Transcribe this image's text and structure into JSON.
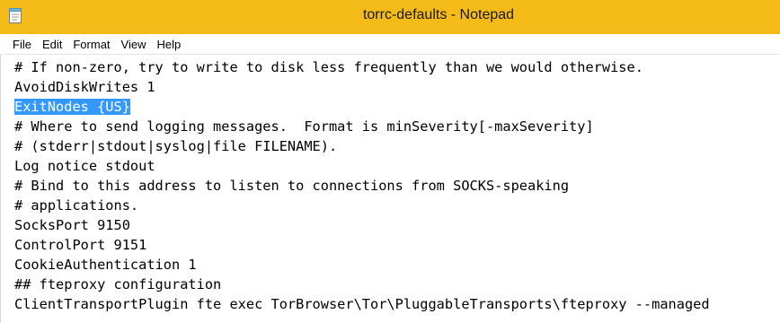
{
  "window": {
    "title": "torrc-defaults - Notepad",
    "title_bar_color": "#f4bb19",
    "selection_color": "#3399ff"
  },
  "icons": {
    "app": "notepad-icon"
  },
  "menu": {
    "items": [
      "File",
      "Edit",
      "Format",
      "View",
      "Help"
    ]
  },
  "editor": {
    "lines": [
      "# If non-zero, try to write to disk less frequently than we would otherwise.",
      "AvoidDiskWrites 1",
      "ExitNodes {US}",
      "# Where to send logging messages.  Format is minSeverity[-maxSeverity]",
      "# (stderr|stdout|syslog|file FILENAME).",
      "Log notice stdout",
      "# Bind to this address to listen to connections from SOCKS-speaking",
      "# applications.",
      "SocksPort 9150",
      "ControlPort 9151",
      "CookieAuthentication 1",
      "## fteproxy configuration",
      "ClientTransportPlugin fte exec TorBrowser\\Tor\\PluggableTransports\\fteproxy --managed"
    ],
    "selected_line_index": 2
  }
}
